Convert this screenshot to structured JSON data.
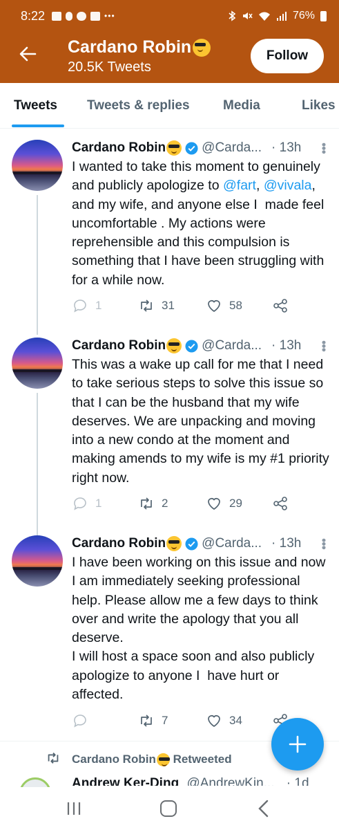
{
  "status_bar": {
    "time": "8:22",
    "battery": "76%",
    "icons": [
      "voicemail-icon",
      "usb-icon",
      "cloud-icon",
      "image-icon",
      "more-dots-icon",
      "bluetooth-icon",
      "mute-icon",
      "wifi-icon",
      "signal-icon",
      "battery-icon"
    ]
  },
  "header": {
    "name": "Cardano Robin",
    "tweet_count": "20.5K Tweets",
    "follow_label": "Follow",
    "accent_color": "#b45411"
  },
  "tabs": [
    {
      "label": "Tweets",
      "active": true
    },
    {
      "label": "Tweets & replies",
      "active": false
    },
    {
      "label": "Media",
      "active": false
    },
    {
      "label": "Likes",
      "active": false
    }
  ],
  "tweets": [
    {
      "name": "Cardano Robin",
      "handle": "@Carda...",
      "time": "· 13h",
      "text_before": "I wanted to take this moment to genuinely and publicly apologize to ",
      "mention1": "@fart",
      "text_mid": ", ",
      "mention2": "@vivala",
      "text_after": ", and my wife, and anyone else I  made feel uncomfortable . My actions were reprehensible and this compulsion is something that I have been struggling with for a while now.",
      "replies": "1",
      "retweets": "31",
      "likes": "58"
    },
    {
      "name": "Cardano Robin",
      "handle": "@Carda...",
      "time": "· 13h",
      "text": "This was a wake up call for me that I need to take serious steps to solve this issue so that I can be the husband that my wife deserves. We are unpacking and moving into a new condo at the moment and making amends to my wife is my #1 priority right now.",
      "replies": "1",
      "retweets": "2",
      "likes": "29"
    },
    {
      "name": "Cardano Robin",
      "handle": "@Carda...",
      "time": "· 13h",
      "text": "I have been working on this issue and now I am immediately seeking professional help. Please allow me a few days to think over and write the apology that you all deserve.\nI will host a space soon and also publicly apologize to anyone I  have hurt or affected.",
      "retweets": "7",
      "likes": "34"
    }
  ],
  "retweet_row": {
    "name": "Cardano Robin",
    "suffix": " Retweeted"
  },
  "next_tweet": {
    "name": "Andrew Ker-Ding",
    "handle": "@AndrewKin...",
    "time": "· 1d"
  }
}
